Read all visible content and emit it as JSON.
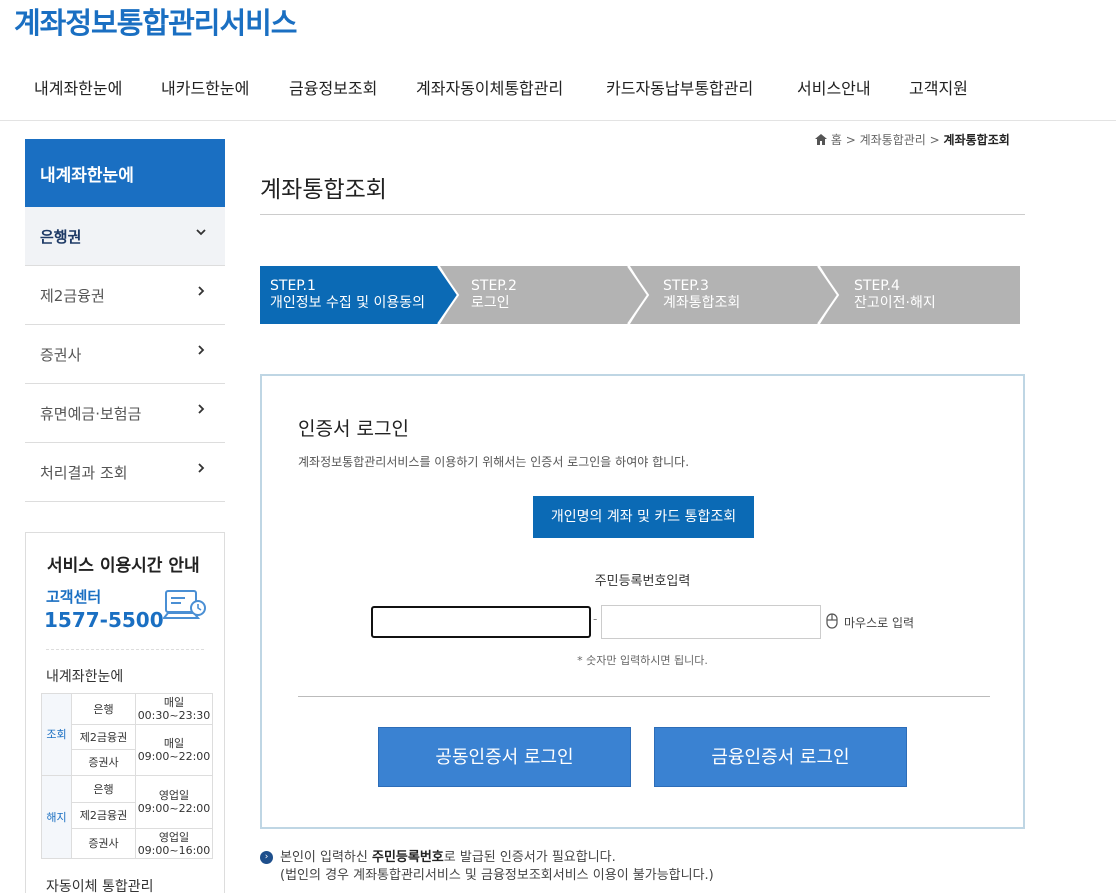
{
  "site": {
    "title": "계좌정보통합관리서비스"
  },
  "gnb": [
    "내계좌한눈에",
    "내카드한눈에",
    "금융정보조회",
    "계좌자동이체통합관리",
    "카드자동납부통합관리",
    "서비스안내",
    "고객지원"
  ],
  "lnb": {
    "title": "내계좌한눈에",
    "items": [
      "은행권",
      "제2금융권",
      "증권사",
      "휴면예금·보험금",
      "처리결과 조회"
    ]
  },
  "service_info": {
    "title": "서비스 이용시간 안내",
    "center_label": "고객센터",
    "center_number": "1577-5500",
    "section_label": "내계좌한눈에",
    "table": {
      "cat_query": "조회",
      "cat_cancel": "해지",
      "bank": "은행",
      "second": "제2금융권",
      "securities": "증권사",
      "q_bank_days": "매일",
      "q_bank_hours": "00:30~23:30",
      "q_other_days": "매일",
      "q_other_hours": "09:00~22:00",
      "c_bank_days": "영업일",
      "c_bank_hours": "09:00~22:00",
      "c_sec_days": "영업일",
      "c_sec_hours": "09:00~16:00"
    },
    "next_label": "자동이체 통합관리"
  },
  "breadcrumb": {
    "home": "홈",
    "parent": "계좌통합관리",
    "current": "계좌통합조회"
  },
  "page_title": "계좌통합조회",
  "steps": [
    {
      "num": "STEP.1",
      "label": "개인정보 수집 및 이용동의",
      "active": true
    },
    {
      "num": "STEP.2",
      "label": "로그인",
      "active": false
    },
    {
      "num": "STEP.3",
      "label": "계좌통합조회",
      "active": false
    },
    {
      "num": "STEP.4",
      "label": "잔고이전·해지",
      "active": false
    }
  ],
  "colors": {
    "step_active": "#0b6ab5",
    "step_inactive": "#b3b3b3"
  },
  "login": {
    "title": "인증서 로그인",
    "desc": "계좌정보통합관리서비스를 이용하기 위해서는 인증서 로그인을 하여야 합니다.",
    "unified_button": "개인명의 계좌 및 카드 통합조회",
    "rrn_label": "주민등록번호입력",
    "rrn_front_value": "",
    "rrn_back_value": "",
    "rrn_dash": "-",
    "mouse_input": "마우스로 입력",
    "rrn_note": "* 숫자만 입력하시면 됩니다.",
    "joint_cert_button": "공동인증서 로그인",
    "finance_cert_button": "금융인증서 로그인"
  },
  "notice": {
    "line1_pre": "본인이 입력하신 ",
    "line1_bold": "주민등록번호",
    "line1_post": "로 발급된 인증서가 필요합니다.",
    "line2": "(법인의 경우 계좌통합관리서비스 및 금융정보조회서비스 이용이 불가능합니다.)"
  }
}
